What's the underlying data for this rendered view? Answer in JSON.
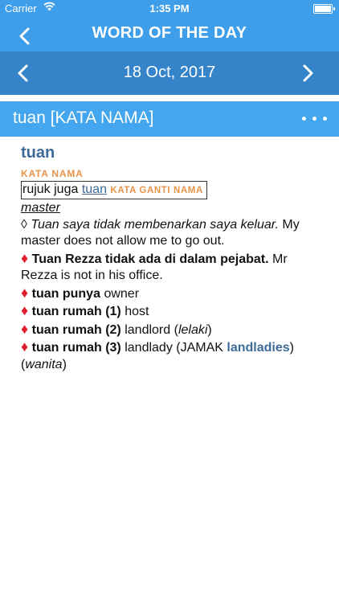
{
  "status_bar": {
    "carrier": "Carrier",
    "time": "1:35 PM"
  },
  "nav": {
    "title": "WORD OF THE DAY"
  },
  "date_bar": {
    "date": "18 Oct, 2017"
  },
  "headword_bar": {
    "title": "tuan [KATA NAMA]"
  },
  "entry": {
    "word": "tuan",
    "pos": "KATA NAMA",
    "see_also": {
      "prefix": "rujuk juga",
      "link": "tuan",
      "pos": "KATA GANTI NAMA"
    },
    "translation": "master",
    "example": {
      "malay": "Tuan saya tidak membenarkan saya keluar.",
      "english": "My master does not allow me to go out."
    },
    "senses": [
      {
        "malay": "Tuan Rezza tidak ada di dalam pejabat.",
        "english": "Mr Rezza is not in his office."
      },
      {
        "malay": "tuan punya",
        "english": "owner"
      },
      {
        "malay": "tuan rumah (1)",
        "english": "host"
      },
      {
        "malay": "tuan rumah (2)",
        "english": "landlord",
        "note": "lelaki"
      },
      {
        "malay": "tuan rumah (3)",
        "english": "landlady",
        "plural_label": "JAMAK",
        "plural": "landladies",
        "note": "wanita"
      }
    ]
  },
  "icons": {
    "back": "chevron-left-icon",
    "prev": "chevron-left-icon",
    "next": "chevron-right-icon",
    "more": "more-dots-icon",
    "wifi": "wifi-icon",
    "battery": "battery-icon"
  },
  "colors": {
    "nav": "#3f9ee9",
    "date_bar": "#3583c9",
    "headword_bar": "#44a6ee",
    "link": "#3d6b99",
    "pos": "#e8944a",
    "diamond": "#e0202e"
  }
}
